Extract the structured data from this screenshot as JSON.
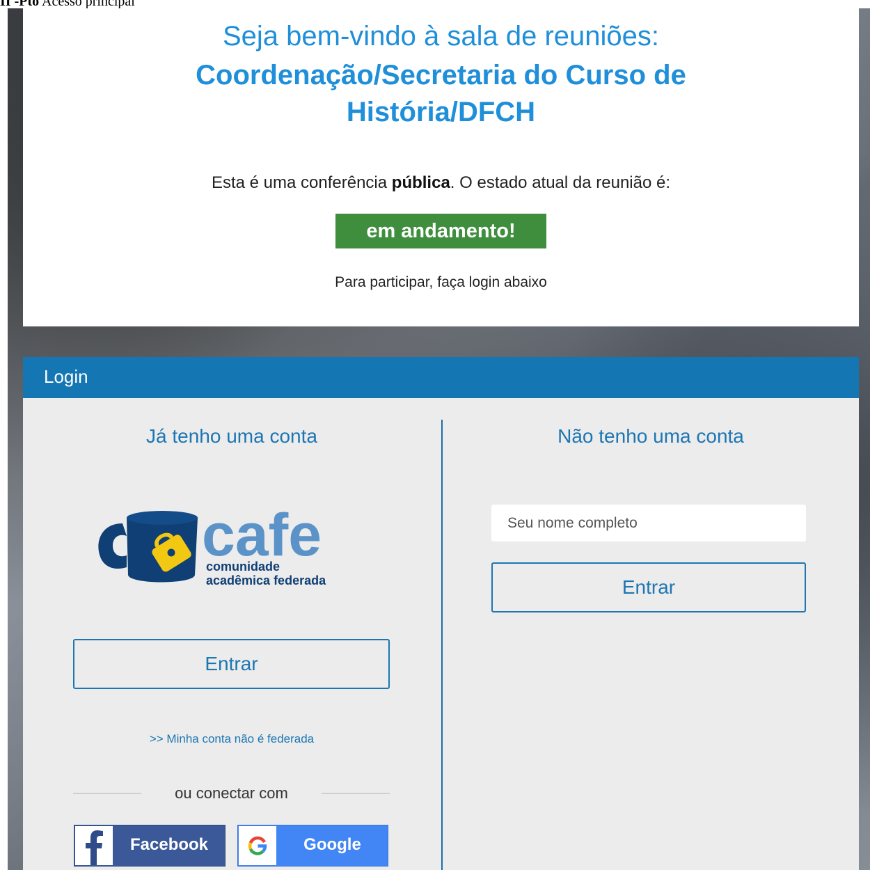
{
  "caption": {
    "prefix": "II -Pto",
    "text": " Acesso principal"
  },
  "welcome": {
    "line1": "Seja bem-vindo à sala de reuniões:",
    "room_name": "Coordenação/Secretaria do Curso de História/DFCH",
    "status_prefix": "Esta é uma conferência ",
    "status_bold": "pública",
    "status_suffix": ". O estado atual da reunião é:",
    "status_badge": "em andamento!",
    "login_hint": "Para participar, faça login abaixo"
  },
  "login": {
    "header": "Login",
    "left": {
      "title": "Já tenho uma conta",
      "logo": {
        "word": "cafe",
        "line1": "comunidade",
        "line2": "acadêmica federada"
      },
      "enter_label": "Entrar",
      "non_federated_link": ">> Minha conta não é federada",
      "or_connect": "ou conectar com",
      "facebook_label": "Facebook",
      "google_label": "Google"
    },
    "right": {
      "title": "Não tenho uma conta",
      "name_placeholder": "Seu nome completo",
      "enter_label": "Entrar"
    }
  },
  "colors": {
    "accent": "#1d76b2",
    "header_bg": "#1576b4",
    "status_green": "#3e8e3e",
    "facebook": "#3b5998",
    "google": "#4285f4"
  },
  "icons": [
    "cafe-logo",
    "facebook-icon",
    "google-icon"
  ]
}
